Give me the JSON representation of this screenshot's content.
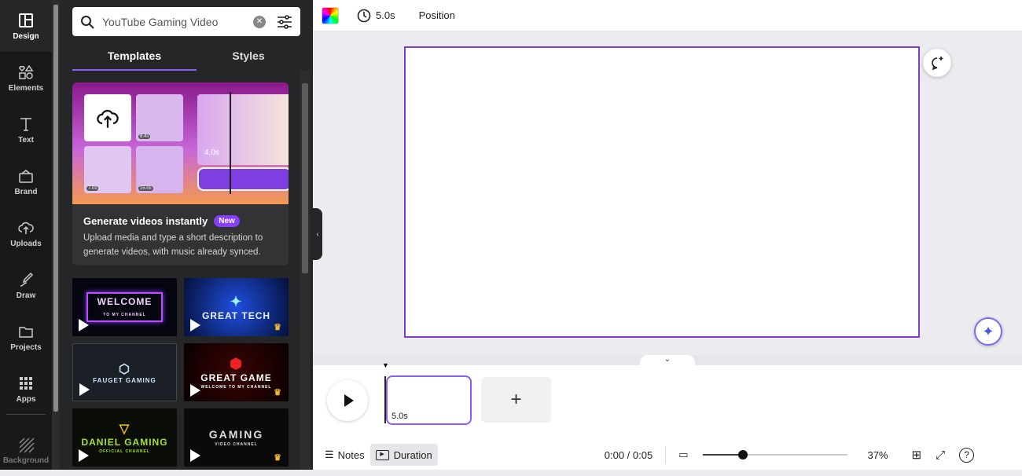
{
  "rail": [
    {
      "label": "Design",
      "icon": "layout-icon"
    },
    {
      "label": "Elements",
      "icon": "shapes-icon"
    },
    {
      "label": "Text",
      "icon": "text-icon"
    },
    {
      "label": "Brand",
      "icon": "brand-icon"
    },
    {
      "label": "Uploads",
      "icon": "upload-cloud-icon"
    },
    {
      "label": "Draw",
      "icon": "draw-icon"
    },
    {
      "label": "Projects",
      "icon": "folder-icon"
    },
    {
      "label": "Apps",
      "icon": "apps-grid-icon"
    },
    {
      "label": "Background",
      "icon": "background-icon"
    }
  ],
  "search": {
    "value": "YouTube Gaming Video"
  },
  "tabs": {
    "templates": "Templates",
    "styles": "Styles"
  },
  "promo": {
    "title": "Generate videos instantly",
    "badge": "New",
    "description": "Upload media and type a short description to generate videos, with music already synced.",
    "durations": [
      "8.4s",
      "7.0s",
      "15.0s",
      "4.0s"
    ]
  },
  "templates": [
    {
      "title": "WELCOME",
      "subtitle": "TO MY CHANNEL",
      "premium": false
    },
    {
      "title": "GREAT TECH",
      "subtitle": "",
      "premium": true
    },
    {
      "title": "FAUGET GAMING",
      "subtitle": "",
      "premium": false
    },
    {
      "title": "GREAT GAME",
      "subtitle": "WELCOME TO MY CHANNEL",
      "premium": true
    },
    {
      "title": "DANIEL GAMING",
      "subtitle": "OFFICIAL CHANNEL",
      "premium": false
    },
    {
      "title": "GAMING",
      "subtitle": "VIDEO CHANNEL",
      "premium": true
    }
  ],
  "toolbar": {
    "duration": "5.0s",
    "position": "Position"
  },
  "timeline": {
    "clip_duration": "5.0s"
  },
  "bottom": {
    "notes": "Notes",
    "duration": "Duration",
    "time": "0:00 / 0:05",
    "zoom": "37%",
    "zoom_fraction": 0.37
  },
  "colors": {
    "accent": "#8b3dff",
    "page_border": "#7d3cd6"
  }
}
